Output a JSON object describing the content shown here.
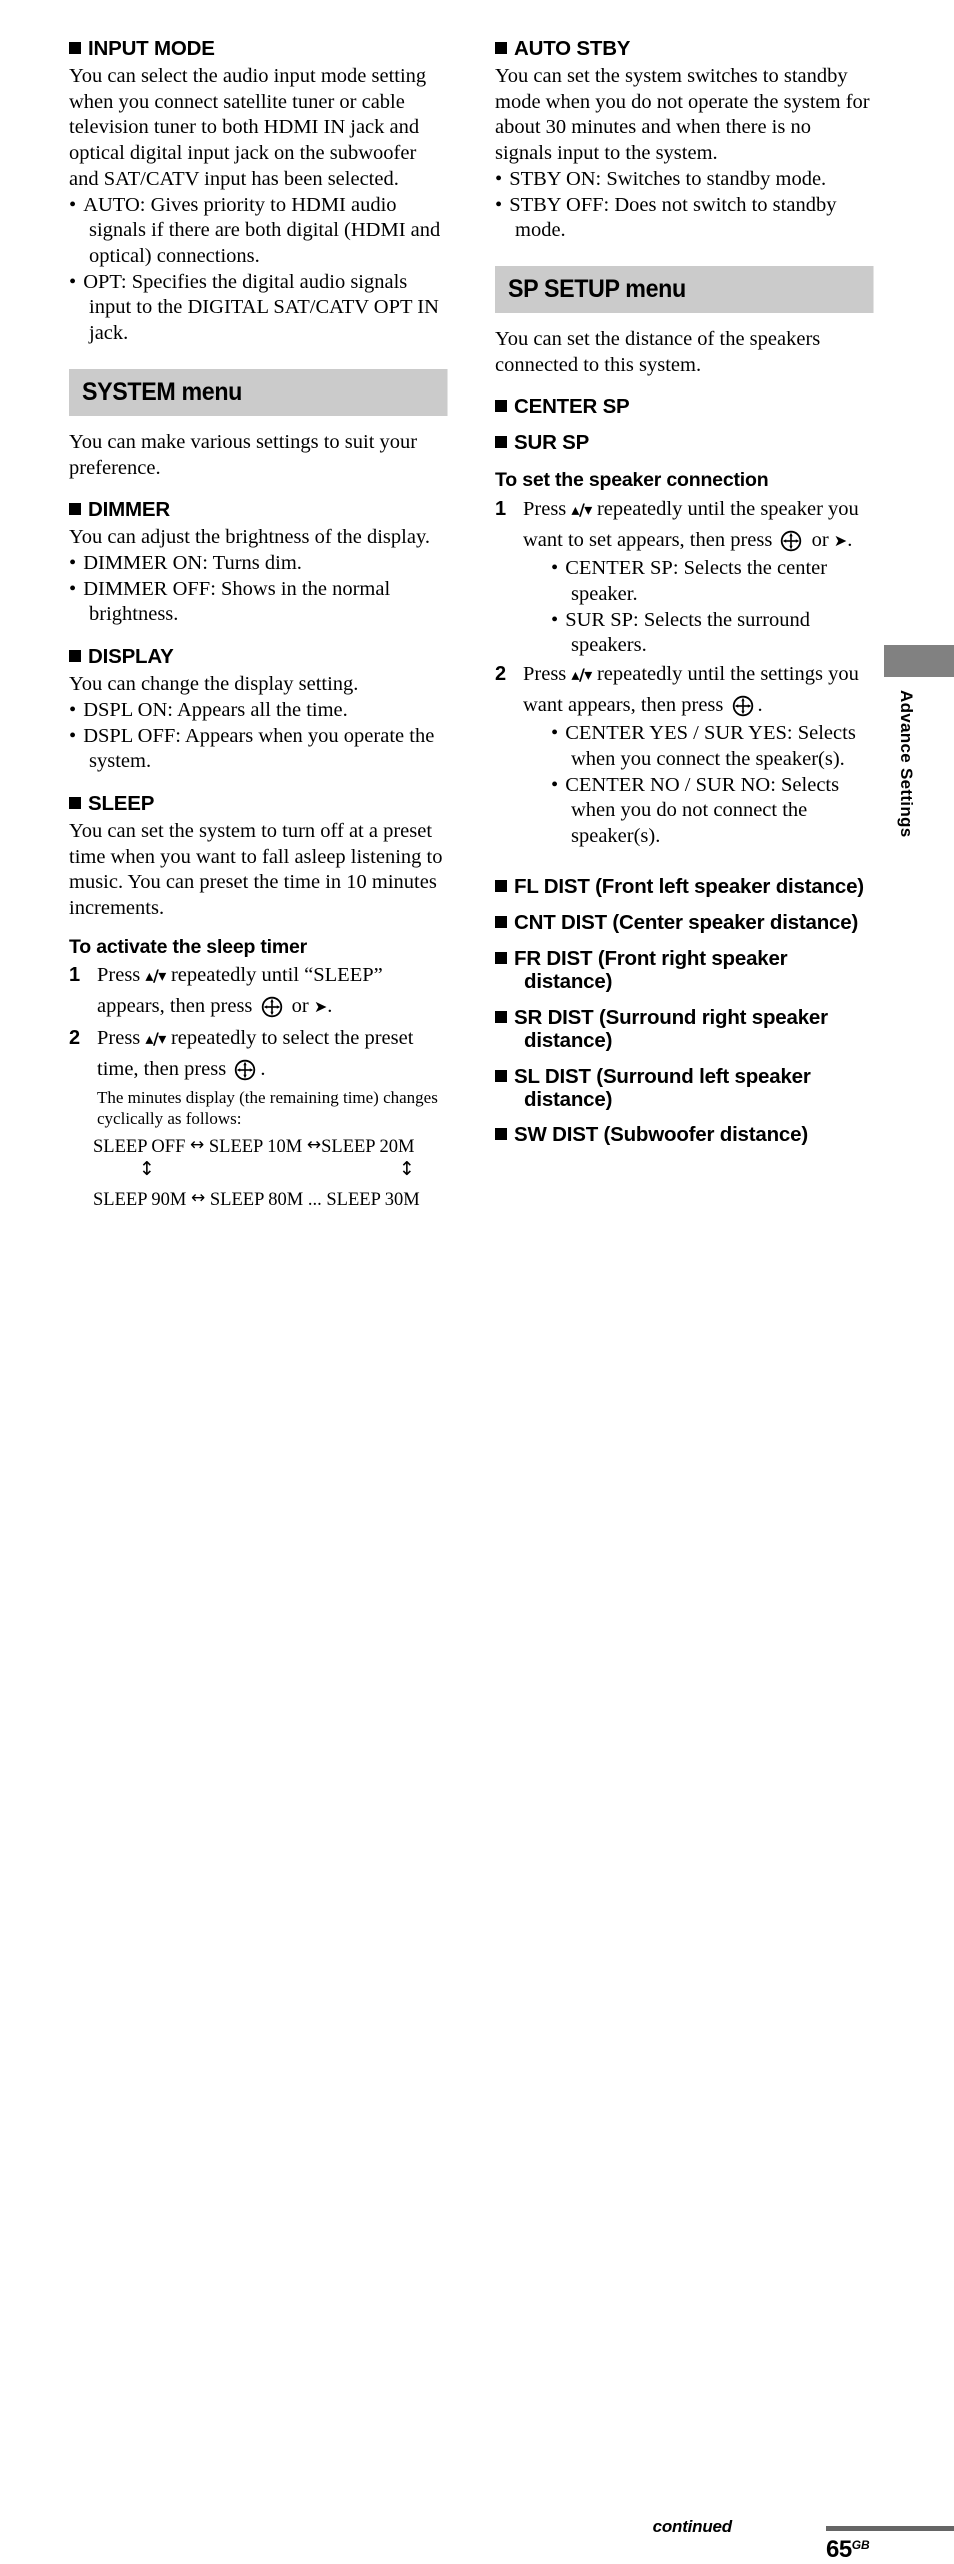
{
  "page": {
    "number": "65",
    "region_code": "GB",
    "continued_label": "continued",
    "side_tab_label": "Advance Settings",
    "banner_color": "#cbcbcb",
    "side_tab_color": "#818181",
    "rule_color": "#656565"
  },
  "left_column": {
    "input_mode": {
      "heading": "INPUT MODE",
      "body": "You can select the audio input mode setting when you connect satellite tuner or cable television tuner to both HDMI IN jack and optical digital input jack on the subwoofer and SAT/CATV input has been selected.",
      "bullets": [
        "AUTO: Gives priority to HDMI audio signals if there are both digital (HDMI and optical) connections.",
        "OPT: Specifies the digital audio signals input to the DIGITAL SAT/CATV OPT IN jack."
      ]
    },
    "system_menu": {
      "banner": "SYSTEM menu",
      "body": "You can make various settings to suit your preference."
    },
    "dimmer": {
      "heading": "DIMMER",
      "body": "You can adjust the brightness of the display.",
      "bullets": [
        "DIMMER ON: Turns dim.",
        "DIMMER OFF: Shows in the normal brightness."
      ]
    },
    "display": {
      "heading": "DISPLAY",
      "body": "You can change the display setting.",
      "bullets": [
        "DSPL ON: Appears all the time.",
        "DSPL OFF: Appears when you operate the system."
      ]
    },
    "sleep": {
      "heading": "SLEEP",
      "body": "You can set the system to turn off at a preset time when you want to fall asleep listening to music. You can preset the time in 10 minutes increments.",
      "procedure_title": "To activate the sleep timer",
      "step1_num": "1",
      "step1_a": "Press ",
      "step1_updown": "♦/♦",
      "step1_b": " repeatedly until “SLEEP” appears, then press ",
      "step1_or": " or ",
      "step1_rarrow": "➔",
      "step1_end": ".",
      "step2_num": "2",
      "step2_a": "Press ",
      "step2_updown": "♦/♦",
      "step2_b": " repeatedly to select the preset time, then press ",
      "step2_end": ".",
      "note": "The minutes display (the remaining time) changes cyclically as follows:",
      "cycle": {
        "row1_item1": "SLEEP OFF",
        "row1_arrow1": "↔",
        "row1_item2": "SLEEP 10M",
        "row1_arrow2": "↔",
        "row1_item3": "SLEEP 20M",
        "mid_arrow_left": "↕",
        "mid_arrow_right": "↕",
        "row3_item1": "SLEEP 90M",
        "row3_arrow1": "↔",
        "row3_item2": "SLEEP 80M",
        "row3_ellipsis": "...",
        "row3_item3": "SLEEP 30M"
      }
    }
  },
  "right_column": {
    "auto_stby": {
      "heading": "AUTO STBY",
      "body": "You can set the system switches to standby mode when you do not operate the system for about 30 minutes and when there is no signals input to the system.",
      "bullets": [
        "STBY ON: Switches to standby mode.",
        "STBY OFF: Does not switch to standby mode."
      ]
    },
    "sp_setup_menu": {
      "banner": "SP SETUP menu",
      "body": "You can set the distance of the speakers connected to this system."
    },
    "center_sp": {
      "heading": "CENTER SP"
    },
    "sur_sp": {
      "heading": "SUR SP"
    },
    "speaker_connection": {
      "procedure_title": "To set the speaker connection",
      "step1_num": "1",
      "step1_a": "Press ",
      "step1_updown": "♦/♦",
      "step1_b": " repeatedly until the speaker you want to set appears, then press ",
      "step1_or": " or ",
      "step1_rarrow": "➔",
      "step1_end": ".",
      "step1_bullets": [
        "CENTER SP: Selects the center speaker.",
        "SUR SP: Selects the surround speakers."
      ],
      "step2_num": "2",
      "step2_a": "Press ",
      "step2_updown": "♦/♦",
      "step2_b": " repeatedly until the settings you want appears, then press ",
      "step2_end": ".",
      "step2_bullets": [
        "CENTER YES / SUR YES: Selects when you connect the speaker(s).",
        "CENTER NO / SUR NO: Selects when you do not connect the speaker(s)."
      ]
    },
    "distance_headings": [
      "FL DIST (Front left speaker distance)",
      "CNT DIST (Center speaker distance)",
      "FR DIST (Front right speaker distance)",
      "SR DIST (Surround right speaker distance)",
      "SL DIST (Surround left speaker distance)",
      "SW DIST (Subwoofer distance)"
    ]
  }
}
